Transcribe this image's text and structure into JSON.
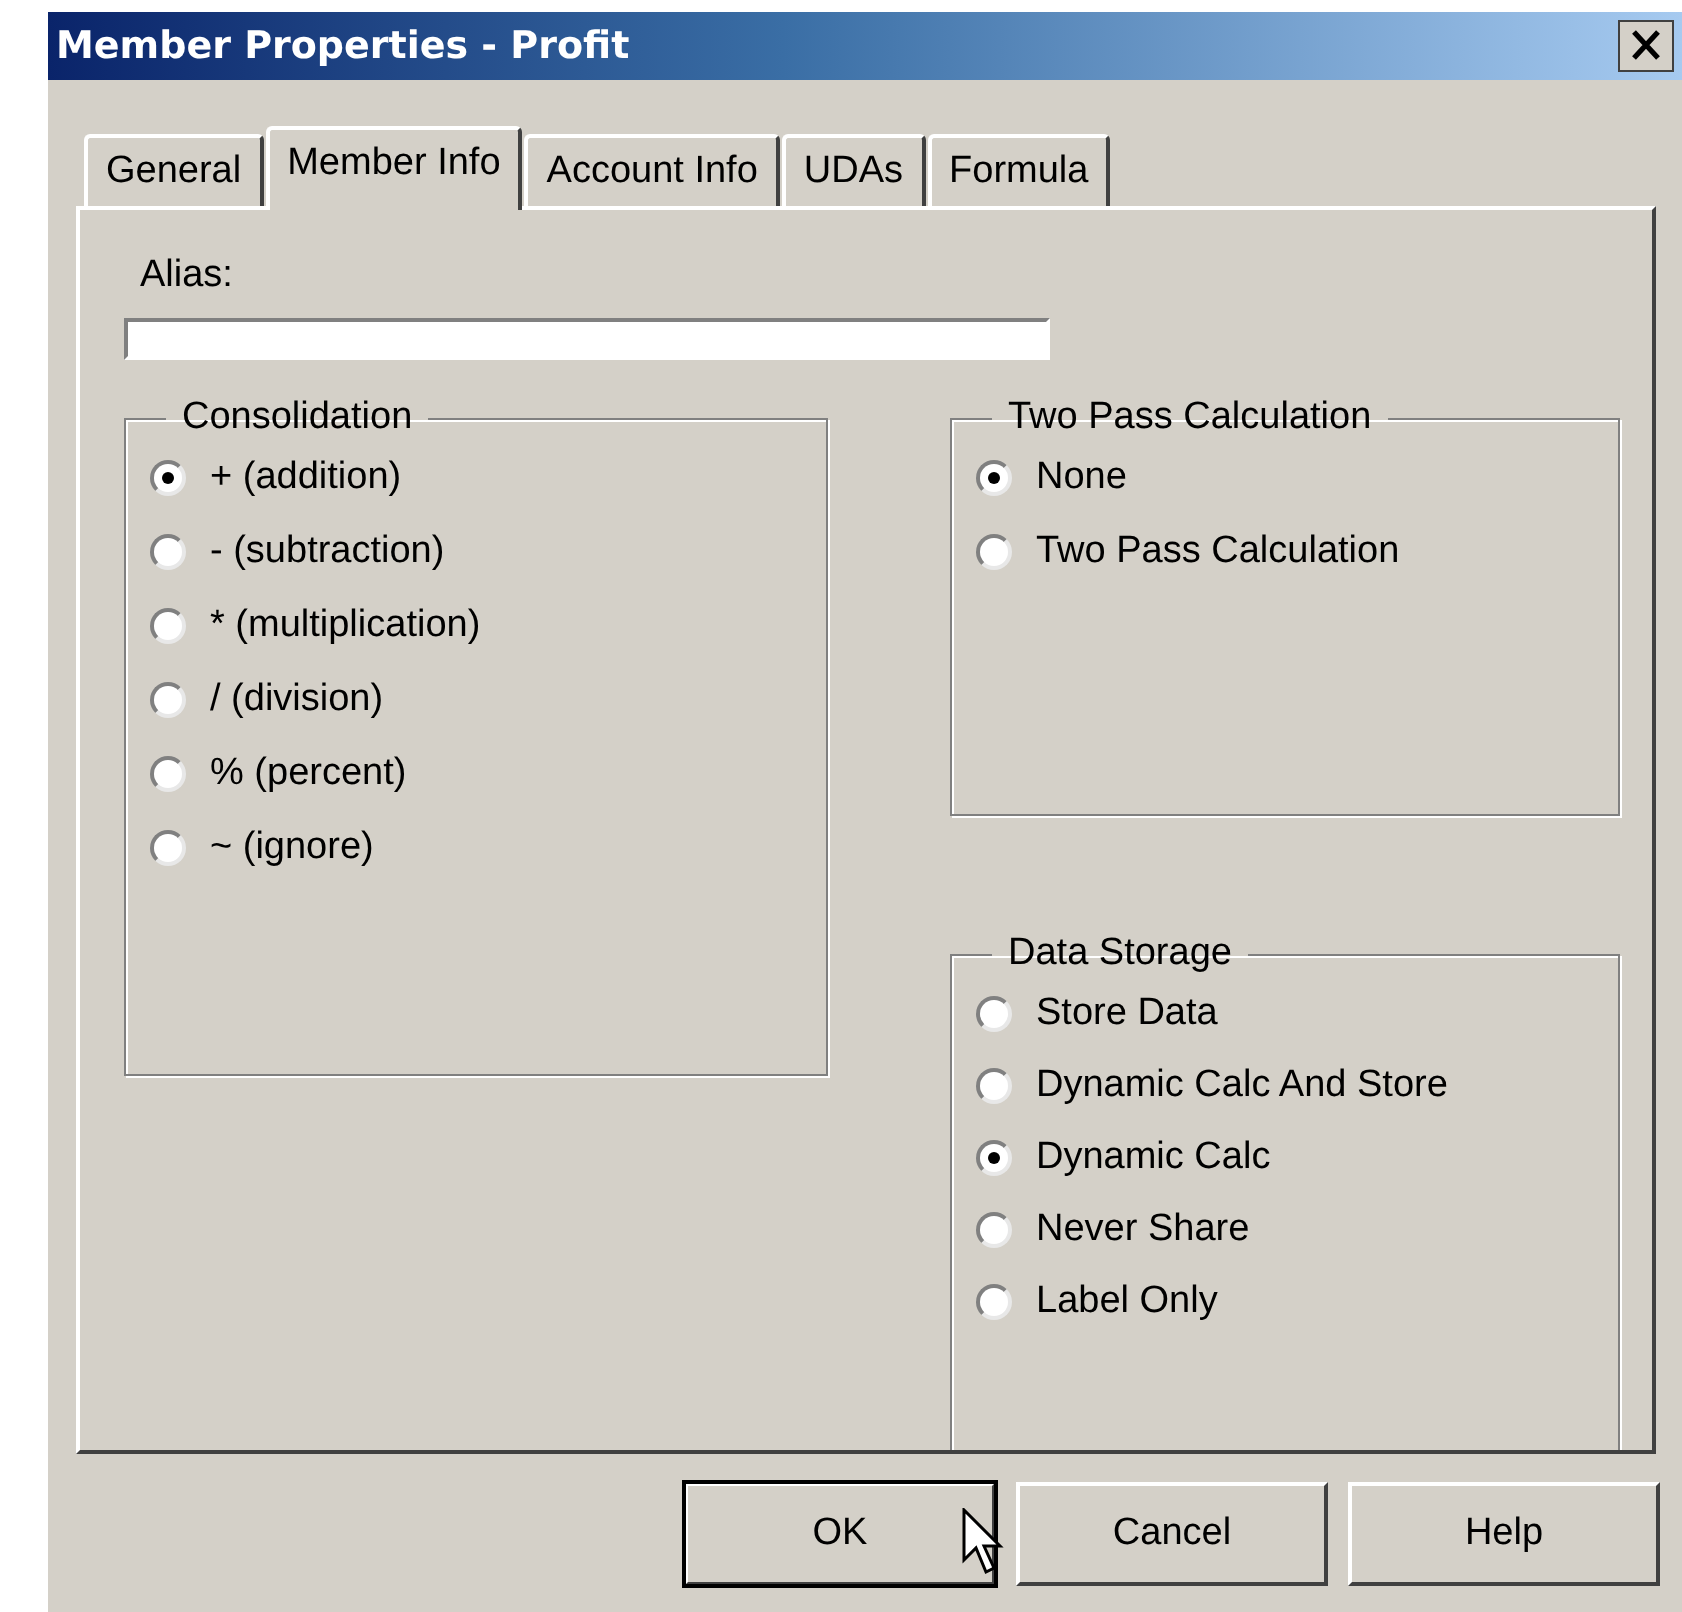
{
  "window": {
    "title": "Member Properties - Profit"
  },
  "tabs": [
    {
      "label": "General",
      "selected": false
    },
    {
      "label": "Member Info",
      "selected": true
    },
    {
      "label": "Account Info",
      "selected": false
    },
    {
      "label": "UDAs",
      "selected": false
    },
    {
      "label": "Formula",
      "selected": false
    }
  ],
  "alias": {
    "label": "Alias:"
  },
  "groups": [
    {
      "title": "Consolidation",
      "options": [
        {
          "label": "+ (addition)",
          "selected": true
        },
        {
          "label": "- (subtraction)",
          "selected": false
        },
        {
          "label": "* (multiplication)",
          "selected": false
        },
        {
          "label": "/ (division)",
          "selected": false
        },
        {
          "label": "% (percent)",
          "selected": false
        },
        {
          "label": "~ (ignore)",
          "selected": false
        }
      ]
    },
    {
      "title": "Two Pass Calculation",
      "options": [
        {
          "label": "None",
          "selected": true
        },
        {
          "label": "Two Pass Calculation",
          "selected": false
        }
      ]
    },
    {
      "title": "Data Storage",
      "options": [
        {
          "label": "Store Data",
          "selected": false
        },
        {
          "label": "Dynamic Calc And Store",
          "selected": false
        },
        {
          "label": "Dynamic Calc",
          "selected": true
        },
        {
          "label": "Never Share",
          "selected": false
        },
        {
          "label": "Label Only",
          "selected": false
        }
      ]
    }
  ],
  "buttons": [
    {
      "label": "OK",
      "default": true
    },
    {
      "label": "Cancel",
      "default": false
    },
    {
      "label": "Help",
      "default": false
    }
  ]
}
